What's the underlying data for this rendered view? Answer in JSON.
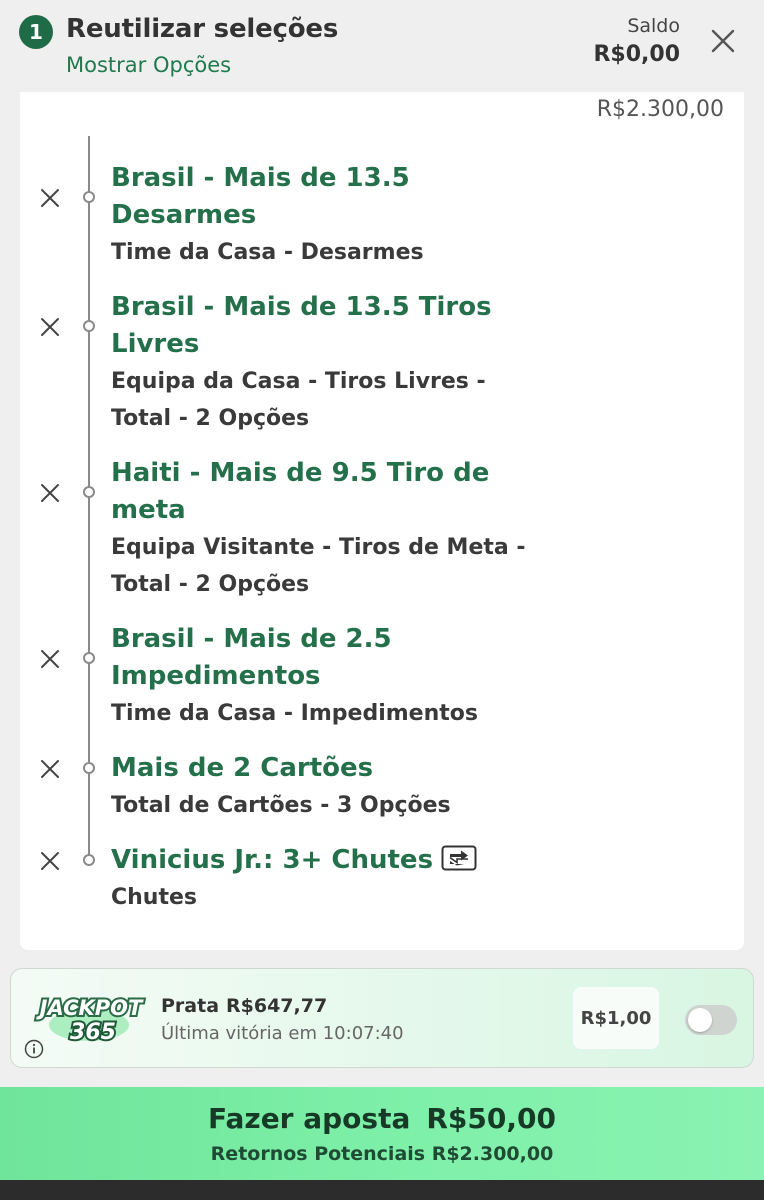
{
  "header": {
    "count": "1",
    "title": "Reutilizar seleções",
    "show_options": "Mostrar Opções",
    "balance_label": "Saldo",
    "balance_value": "R$0,00"
  },
  "betslip": {
    "odds_total": "R$2.300,00",
    "selections": [
      {
        "title": "Brasil - Mais de 13.5 Desarmes",
        "subtitle": "Time da Casa - Desarmes"
      },
      {
        "title": "Brasil - Mais de 13.5 Tiros Livres",
        "subtitle": "Equipa da Casa - Tiros Livres - Total - 2 Opções"
      },
      {
        "title": "Haiti - Mais de 9.5 Tiro de meta",
        "subtitle": "Equipa Visitante - Tiros de Meta - Total - 2 Opções"
      },
      {
        "title": "Brasil - Mais de 2.5 Impedimentos",
        "subtitle": "Time da Casa - Impedimentos"
      },
      {
        "title": "Mais de 2 Cartões",
        "subtitle": "Total de Cartões - 3 Opções"
      },
      {
        "title": "Vinicius Jr.: 3+ Chutes",
        "subtitle": "Chutes",
        "icon": "bet-builder-icon"
      }
    ]
  },
  "jackpot": {
    "logo_text_top": "JACKPOT",
    "logo_text_bottom": "365",
    "tier": "Prata",
    "amount": "R$647,77",
    "last_win": "Última vitória em 10:07:40",
    "stake": "R$1,00",
    "toggle_on": false
  },
  "place_bet": {
    "label": "Fazer aposta",
    "amount": "R$50,00",
    "returns": "Retornos Potenciais R$2.300,00"
  },
  "colors": {
    "brand_green": "#1f6b47",
    "selection_green": "#24704a",
    "cta_green": "#7ff0a9"
  }
}
